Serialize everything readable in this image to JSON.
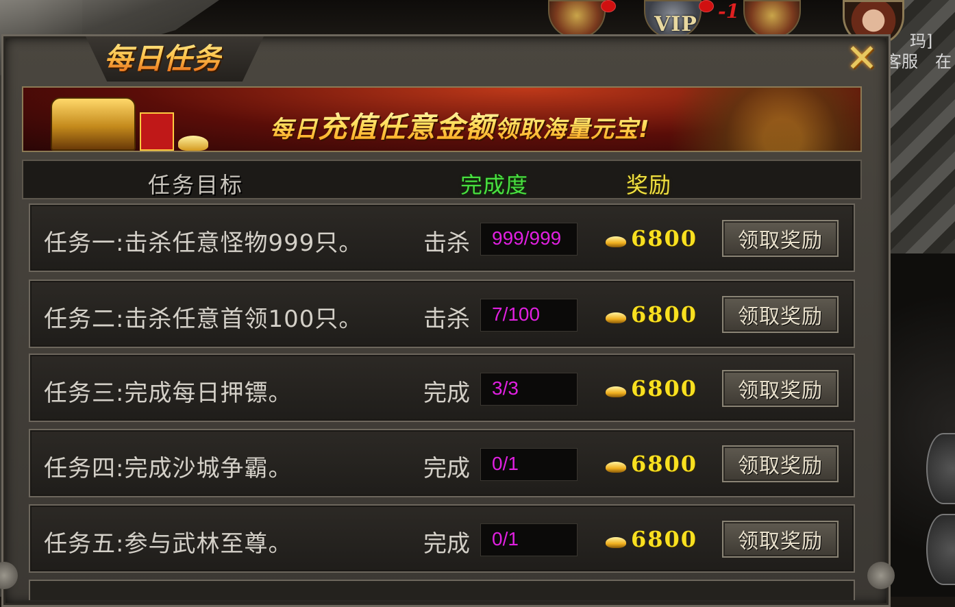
{
  "hud": {
    "vip_label": "VIP",
    "badge_count": "-1",
    "side_text_1": "玛]",
    "side_text_2": "客服",
    "side_text_3": "在"
  },
  "panel": {
    "title": "每日任务",
    "close_icon": "close-x-icon"
  },
  "banner": {
    "text_part1": "每日",
    "text_part2": "充值任意金额",
    "text_part3": "领取海量元宝!"
  },
  "table_header": {
    "goal": "任务目标",
    "progress": "完成度",
    "reward": "奖励"
  },
  "tasks": [
    {
      "name": "任务一:击杀任意怪物999只。",
      "action": "击杀",
      "progress": "999/999",
      "reward": "6800",
      "button": "领取奖励"
    },
    {
      "name": "任务二:击杀任意首领100只。",
      "action": "击杀",
      "progress": "7/100",
      "reward": "6800",
      "button": "领取奖励"
    },
    {
      "name": "任务三:完成每日押镖。",
      "action": "完成",
      "progress": "3/3",
      "reward": "6800",
      "button": "领取奖励"
    },
    {
      "name": "任务四:完成沙城争霸。",
      "action": "完成",
      "progress": "0/1",
      "reward": "6800",
      "button": "领取奖励"
    },
    {
      "name": "任务五:参与武林至尊。",
      "action": "完成",
      "progress": "0/1",
      "reward": "6800",
      "button": "领取奖励"
    }
  ],
  "colors": {
    "progress_text": "#e020e0",
    "reward_text": "#f8e020",
    "header_progress": "#48e040",
    "header_reward": "#f0e040",
    "title_gold": "#ffb020"
  }
}
